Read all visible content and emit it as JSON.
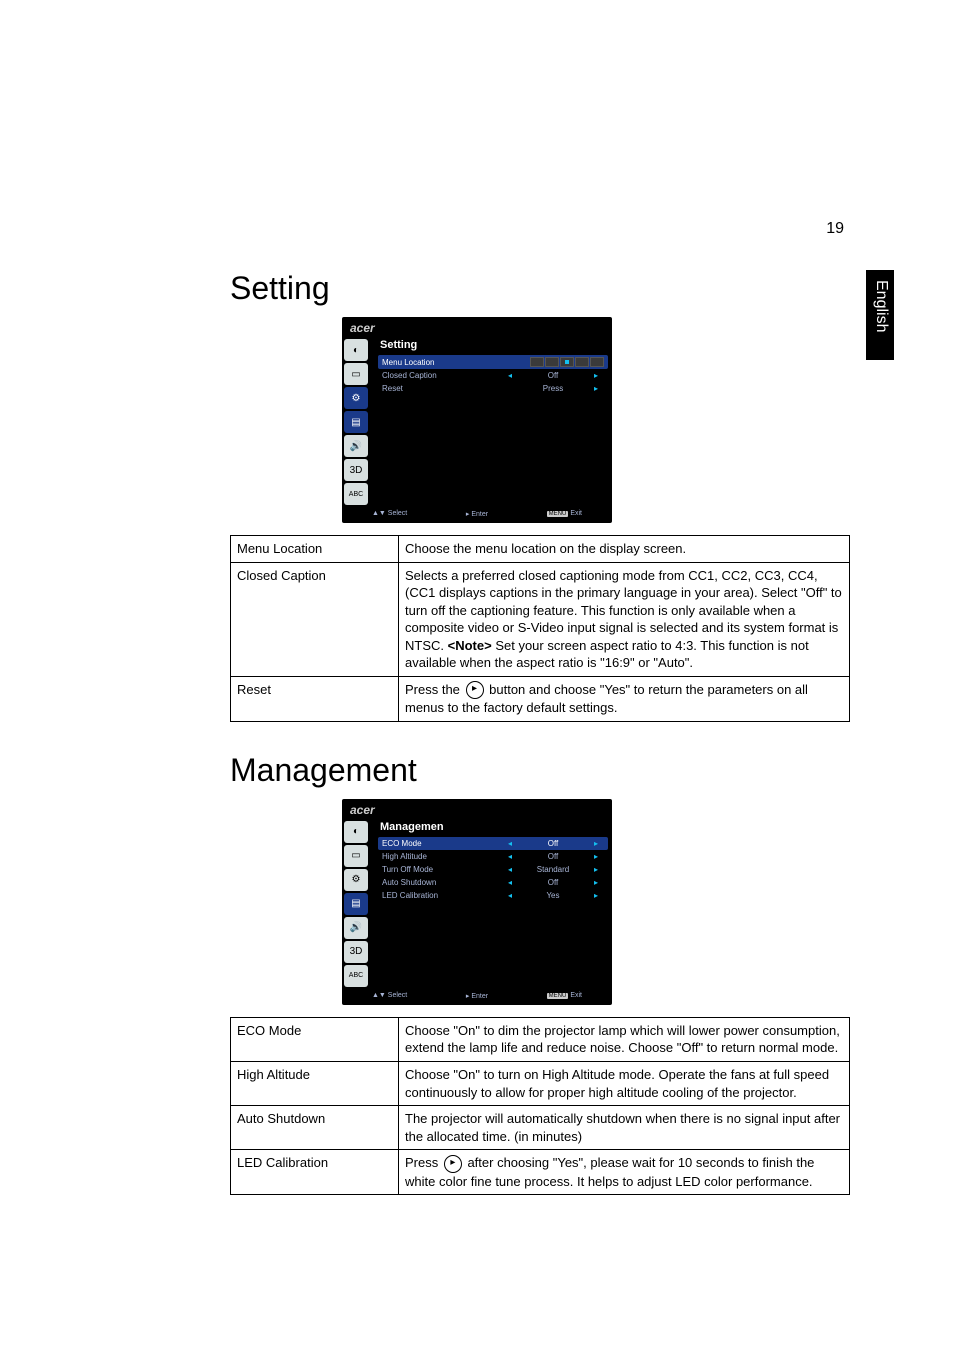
{
  "page_number": "19",
  "side_tab": "English",
  "section_setting": {
    "title": "Setting",
    "osd": {
      "brand": "acer",
      "menu_title": "Setting",
      "rows": [
        {
          "label": "Menu Location",
          "value": "",
          "selected": true,
          "loc_icons": true
        },
        {
          "label": "Closed Caption",
          "value": "Off"
        },
        {
          "label": "Reset",
          "value": "Press"
        }
      ],
      "footer": {
        "select": "▲▼ Select",
        "enter": "▸ Enter",
        "exit_key": "MENU",
        "exit": "Exit"
      }
    },
    "table": [
      {
        "name": "Menu Location",
        "desc": "Choose the menu location on the display screen."
      },
      {
        "name": "Closed Caption",
        "desc": "Selects a preferred closed captioning mode from CC1, CC2, CC3, CC4, (CC1 displays captions in the primary language in your area). Select \"Off\" to turn off the captioning feature. This function is only available when a composite video or S-Video input signal is selected and its system format is NTSC.\n<b><Note></b> Set your screen aspect ratio to 4:3. This function is not available when the aspect ratio is \"16:9\" or \"Auto\"."
      },
      {
        "name": "Reset",
        "desc_pre": "Press the ",
        "desc_post": " button and choose \"Yes\" to return the  parameters on all menus to the factory default settings.",
        "icon": "▸"
      }
    ]
  },
  "section_management": {
    "title": "Management",
    "osd": {
      "brand": "acer",
      "menu_title": "Managemen",
      "rows": [
        {
          "label": "ECO Mode",
          "value": "Off",
          "selected": true
        },
        {
          "label": "High Altitude",
          "value": "Off"
        },
        {
          "label": "Turn Off Mode",
          "value": "Standard"
        },
        {
          "label": "Auto Shutdown",
          "value": "Off"
        },
        {
          "label": "LED Calibration",
          "value": "Yes"
        }
      ],
      "footer": {
        "select": "▲▼ Select",
        "enter": "▸ Enter",
        "exit_key": "MENU",
        "exit": "Exit"
      }
    },
    "table": [
      {
        "name": "ECO Mode",
        "desc": "Choose \"On\" to dim the projector lamp which will lower power consumption, extend the lamp life and reduce noise. Choose \"Off\" to return normal mode."
      },
      {
        "name": "High Altitude",
        "desc": "Choose \"On\" to turn on High Altitude mode. Operate the fans at full speed continuously to allow for proper high altitude cooling of the projector."
      },
      {
        "name": "Auto Shutdown",
        "desc": "The projector will automatically shutdown when there is no signal input after the allocated time. (in minutes)"
      },
      {
        "name": "LED Calibration",
        "desc_pre": "Press ",
        "desc_post": " after choosing \"Yes\", please wait for 10 seconds to finish the white color fine tune process. It helps to adjust LED color performance.",
        "icon": "▸"
      }
    ]
  }
}
